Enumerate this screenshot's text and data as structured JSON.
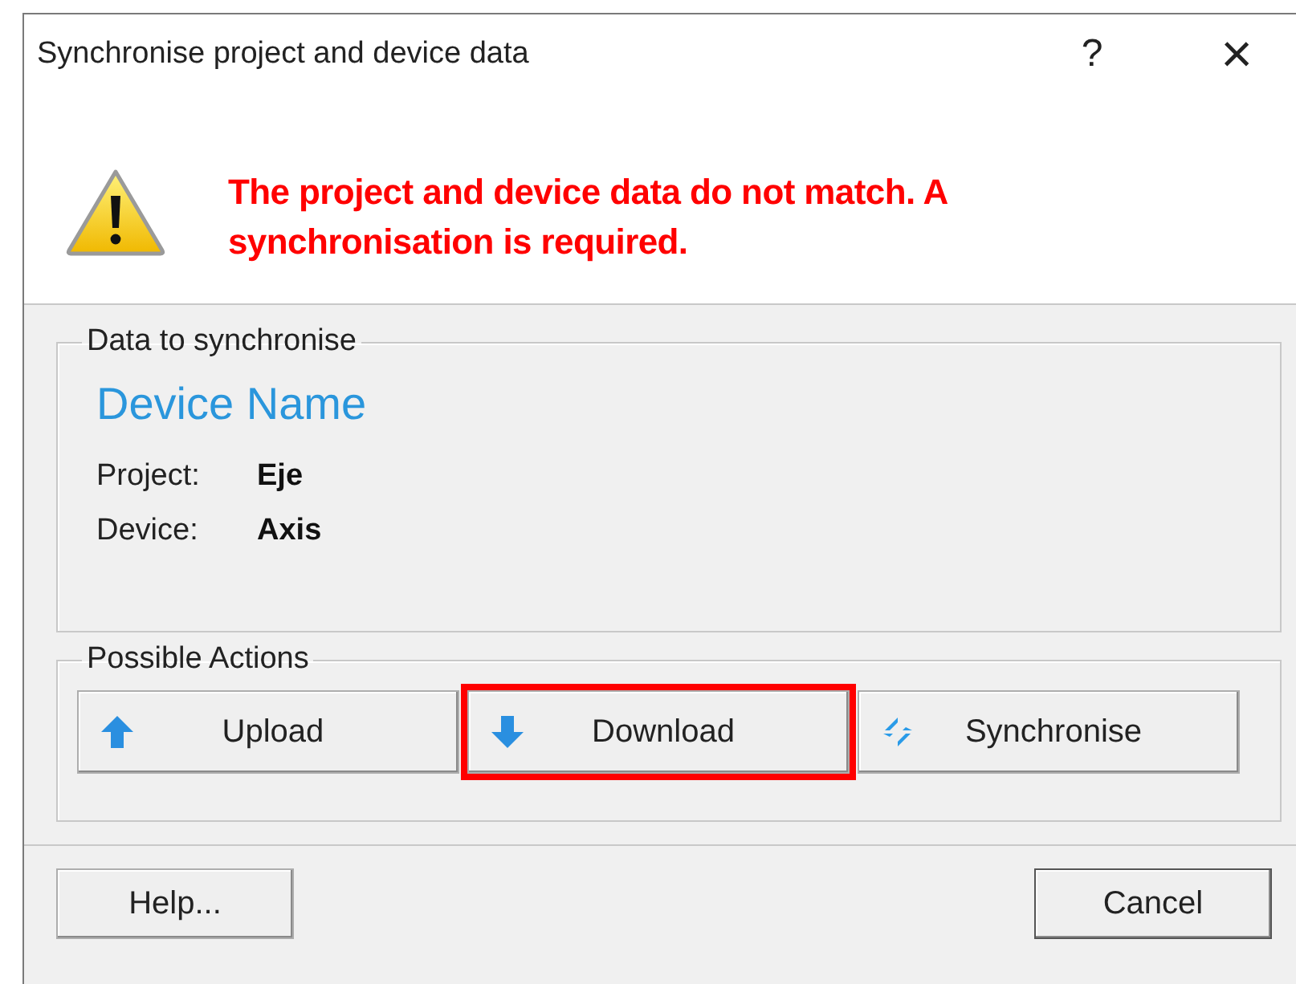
{
  "window": {
    "title": "Synchronise project and device data",
    "help_button": "?",
    "close_button": "×"
  },
  "message": "The project and device data do not match. A synchronisation is required.",
  "data_group": {
    "legend": "Data to synchronise",
    "device_name": "Device Name",
    "fields": [
      {
        "label": "Project:",
        "value": "Eje"
      },
      {
        "label": "Device:",
        "value": "Axis"
      }
    ]
  },
  "actions_group": {
    "legend": "Possible Actions",
    "buttons": [
      {
        "kind": "upload",
        "label": "Upload",
        "highlighted": false
      },
      {
        "kind": "download",
        "label": "Download",
        "highlighted": true
      },
      {
        "kind": "synchronise",
        "label": "Synchronise",
        "highlighted": false
      }
    ]
  },
  "footer": {
    "help": "Help...",
    "cancel": "Cancel"
  }
}
